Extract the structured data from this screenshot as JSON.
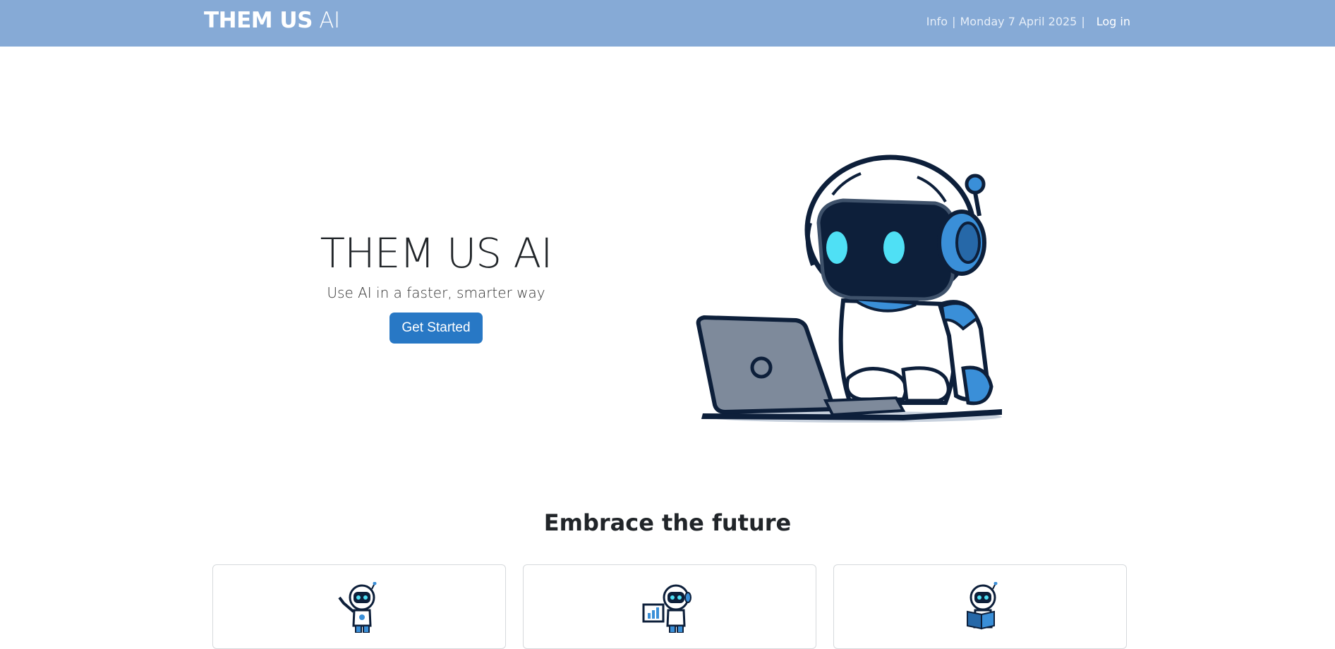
{
  "navbar": {
    "brand_bold": "THEM US",
    "brand_light": "AI",
    "info": "Info",
    "sep1": "|",
    "date": "Monday 7 April 2025",
    "sep2": "|",
    "login": "Log in"
  },
  "hero": {
    "title": "THEM US AI",
    "subtitle": "Use AI in a faster, smarter way",
    "cta": "Get Started",
    "image_icon": "robot-laptop-illustration"
  },
  "features": {
    "title": "Embrace the future",
    "cards": [
      {
        "icon": "robot-waving-icon"
      },
      {
        "icon": "robot-chart-icon"
      },
      {
        "icon": "robot-reading-icon"
      }
    ]
  },
  "colors": {
    "navbar": "#86aad6",
    "button": "#2878c5",
    "robot_dark": "#0d1f3a",
    "robot_blue": "#3a8fd8",
    "robot_eye": "#4fe0f5"
  }
}
